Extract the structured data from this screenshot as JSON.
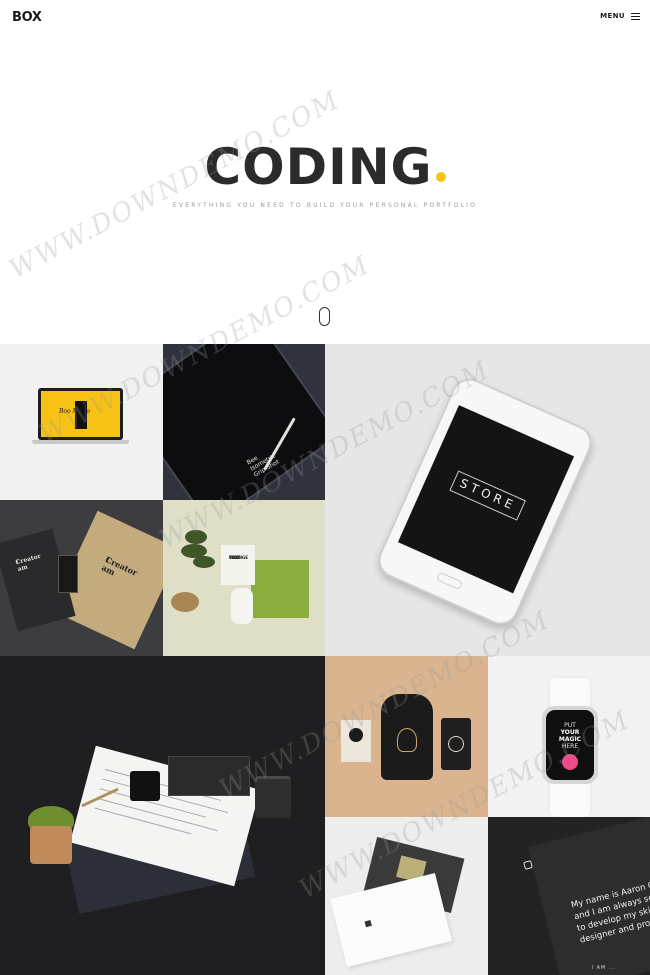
{
  "header": {
    "logo": "BOX",
    "menu_label": "MENU"
  },
  "hero": {
    "title": "CODING",
    "subtitle": "EVERYTHING YOU NEED TO BUILD YOUR PERSONAL PORTFOLIO",
    "accent_color": "#f5c312"
  },
  "portfolio": {
    "laptop_screen_text": "Boo Muno",
    "tablet_text": [
      "Bee",
      "Isometric",
      "Grip Shot"
    ],
    "phone_label": "STORE",
    "tag_card_text": [
      "I am",
      "Creator"
    ],
    "tag_dark_text": [
      "I am",
      "Creator"
    ],
    "green_note_text": [
      "ORANGE",
      "THIS",
      "TEXT"
    ],
    "watch_text": [
      "PUT",
      "YOUR",
      "MAGIC",
      "HERE"
    ],
    "about_text": [
      "My name is Aaron Covin",
      "and I am always search",
      "to develop my skills as",
      "designer and problem"
    ],
    "about_more": "I AM ..."
  },
  "watermark": "WWW.DOWNDEMO.COM",
  "icons": {
    "menu": "hamburger-icon",
    "scroll": "scroll-mouse-icon"
  }
}
